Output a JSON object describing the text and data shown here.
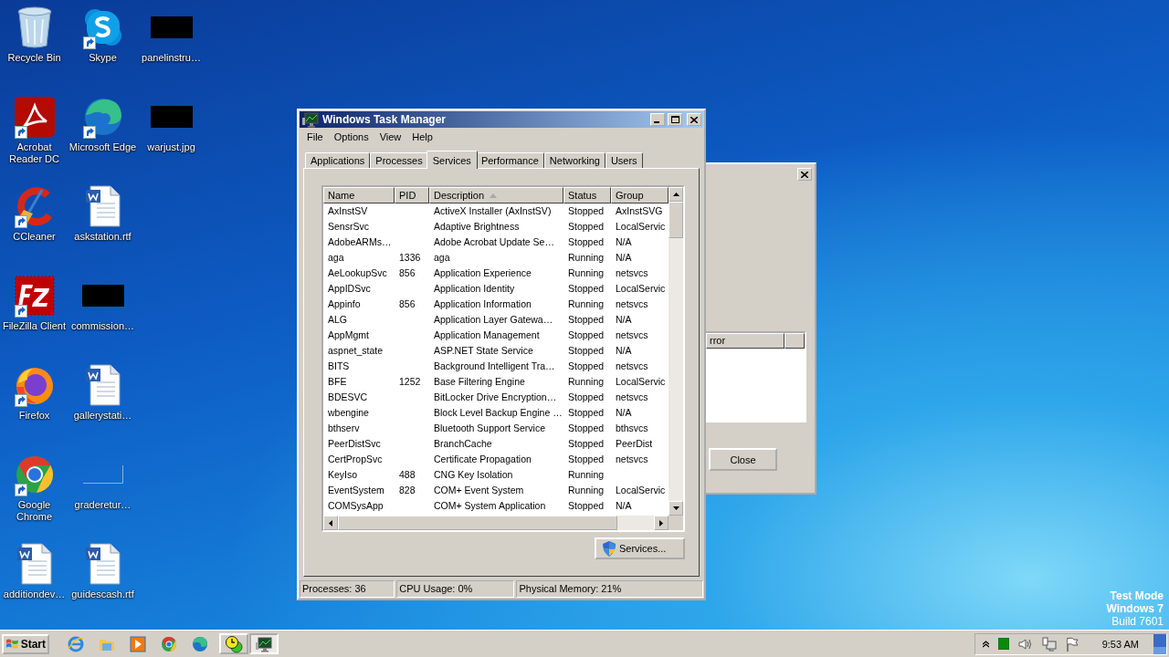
{
  "desktop": {
    "icons": [
      {
        "label": "Recycle Bin",
        "kind": "recycle",
        "shortcut": false
      },
      {
        "label": "Acrobat Reader DC",
        "kind": "acrobat",
        "shortcut": true
      },
      {
        "label": "CCleaner",
        "kind": "ccleaner",
        "shortcut": true
      },
      {
        "label": "FileZilla Client",
        "kind": "filezilla",
        "shortcut": true
      },
      {
        "label": "Firefox",
        "kind": "firefox",
        "shortcut": true
      },
      {
        "label": "Google Chrome",
        "kind": "chrome",
        "shortcut": true
      },
      {
        "label": "additiondev…",
        "kind": "document",
        "shortcut": false
      },
      {
        "label": "Skype",
        "kind": "skype",
        "shortcut": true
      },
      {
        "label": "Microsoft Edge",
        "kind": "edge",
        "shortcut": true
      },
      {
        "label": "askstation.rtf",
        "kind": "document",
        "shortcut": false
      },
      {
        "label": "commission…",
        "kind": "redacted",
        "shortcut": false
      },
      {
        "label": "gallerystati…",
        "kind": "document",
        "shortcut": false
      },
      {
        "label": "graderetur…",
        "kind": "blank",
        "shortcut": false
      },
      {
        "label": "guidescash.rtf",
        "kind": "document",
        "shortcut": false
      },
      {
        "label": "panelinstru…",
        "kind": "redacted",
        "shortcut": false
      },
      {
        "label": "warjust.jpg",
        "kind": "redacted",
        "shortcut": false
      }
    ]
  },
  "back_window": {
    "column_1": "rror",
    "close_button": "Close"
  },
  "task_manager": {
    "title": "Windows Task Manager",
    "menu": [
      "File",
      "Options",
      "View",
      "Help"
    ],
    "tabs": [
      {
        "label": "Applications",
        "selected": false
      },
      {
        "label": "Processes",
        "selected": false
      },
      {
        "label": "Services",
        "selected": true
      },
      {
        "label": "Performance",
        "selected": false
      },
      {
        "label": "Networking",
        "selected": false
      },
      {
        "label": "Users",
        "selected": false
      }
    ],
    "columns": [
      {
        "label": "Name",
        "sorted": false
      },
      {
        "label": "PID",
        "sorted": false
      },
      {
        "label": "Description",
        "sorted": true
      },
      {
        "label": "Status",
        "sorted": false
      },
      {
        "label": "Group",
        "sorted": false
      }
    ],
    "rows": [
      [
        "AxInstSV",
        "",
        "ActiveX Installer (AxInstSV)",
        "Stopped",
        "AxInstSVG"
      ],
      [
        "SensrSvc",
        "",
        "Adaptive Brightness",
        "Stopped",
        "LocalServic"
      ],
      [
        "AdobeARMs…",
        "",
        "Adobe Acrobat Update Se…",
        "Stopped",
        "N/A"
      ],
      [
        "aga",
        "1336",
        "aga",
        "Running",
        "N/A"
      ],
      [
        "AeLookupSvc",
        "856",
        "Application Experience",
        "Running",
        "netsvcs"
      ],
      [
        "AppIDSvc",
        "",
        "Application Identity",
        "Stopped",
        "LocalServic"
      ],
      [
        "Appinfo",
        "856",
        "Application Information",
        "Running",
        "netsvcs"
      ],
      [
        "ALG",
        "",
        "Application Layer Gatewa…",
        "Stopped",
        "N/A"
      ],
      [
        "AppMgmt",
        "",
        "Application Management",
        "Stopped",
        "netsvcs"
      ],
      [
        "aspnet_state",
        "",
        "ASP.NET State Service",
        "Stopped",
        "N/A"
      ],
      [
        "BITS",
        "",
        "Background Intelligent Tra…",
        "Stopped",
        "netsvcs"
      ],
      [
        "BFE",
        "1252",
        "Base Filtering Engine",
        "Running",
        "LocalServic"
      ],
      [
        "BDESVC",
        "",
        "BitLocker Drive Encryption…",
        "Stopped",
        "netsvcs"
      ],
      [
        "wbengine",
        "",
        "Block Level Backup Engine …",
        "Stopped",
        "N/A"
      ],
      [
        "bthserv",
        "",
        "Bluetooth Support Service",
        "Stopped",
        "bthsvcs"
      ],
      [
        "PeerDistSvc",
        "",
        "BranchCache",
        "Stopped",
        "PeerDist"
      ],
      [
        "CertPropSvc",
        "",
        "Certificate Propagation",
        "Stopped",
        "netsvcs"
      ],
      [
        "KeyIso",
        "488",
        "CNG Key Isolation",
        "Running",
        ""
      ],
      [
        "EventSystem",
        "828",
        "COM+ Event System",
        "Running",
        "LocalServic"
      ],
      [
        "COMSysApp",
        "",
        "COM+ System Application",
        "Stopped",
        "N/A"
      ]
    ],
    "services_button": "Services...",
    "status_bar": [
      "Processes: 36",
      "CPU Usage: 0%",
      "Physical Memory: 21%"
    ]
  },
  "test_mode_notice": [
    "Test Mode",
    "Windows 7",
    "Build 7601"
  ],
  "taskbar": {
    "start": "Start",
    "pinned": [
      {
        "kind": "ie"
      },
      {
        "kind": "folder"
      },
      {
        "kind": "media"
      },
      {
        "kind": "chrome"
      },
      {
        "kind": "edge"
      }
    ],
    "tasks": [
      {
        "kind": "clock",
        "selected": false
      },
      {
        "kind": "monitor",
        "selected": true
      }
    ],
    "clock": "9:53 AM"
  }
}
